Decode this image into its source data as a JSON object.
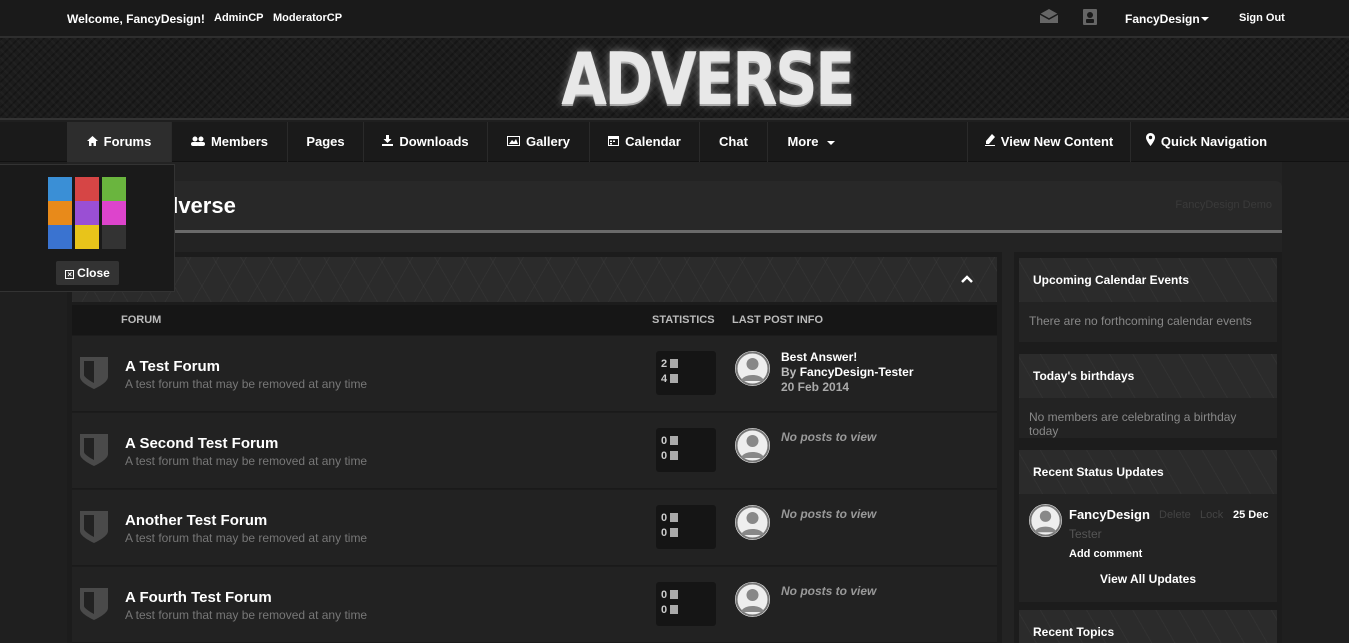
{
  "userbar": {
    "welcome": "Welcome, FancyDesign!",
    "admincp": "AdminCP",
    "moderatorcp": "ModeratorCP",
    "username": "FancyDesign",
    "signout": "Sign Out"
  },
  "header": {
    "logo": "ADVERSE"
  },
  "nav": {
    "forums": "Forums",
    "members": "Members",
    "pages": "Pages",
    "downloads": "Downloads",
    "gallery": "Gallery",
    "calendar": "Calendar",
    "chat": "Chat",
    "more": "More",
    "view_new": "View New Content",
    "quick_nav": "Quick Navigation"
  },
  "page": {
    "title": "Adverse",
    "demo_tag": "FancyDesign Demo"
  },
  "forum_table": {
    "col_forum": "FORUM",
    "col_statistics": "STATISTICS",
    "col_last_post": "LAST POST INFO",
    "rows": [
      {
        "name": "A Test Forum",
        "desc": "A test forum that may be removed at any time",
        "topics": "2",
        "replies": "4",
        "last_title": "Best Answer!",
        "last_by_prefix": "By",
        "last_by": "FancyDesign-Tester",
        "last_date": "20 Feb 2014"
      },
      {
        "name": "A Second Test Forum",
        "desc": "A test forum that may be removed at any time",
        "topics": "0",
        "replies": "0",
        "no_posts": "No posts to view"
      },
      {
        "name": "Another Test Forum",
        "desc": "A test forum that may be removed at any time",
        "topics": "0",
        "replies": "0",
        "no_posts": "No posts to view"
      },
      {
        "name": "A Fourth Test Forum",
        "desc": "A test forum that may be removed at any time",
        "topics": "0",
        "replies": "0",
        "no_posts": "No posts to view"
      }
    ]
  },
  "sidebar": {
    "calendar_title": "Upcoming Calendar Events",
    "calendar_body": "There are no forthcoming calendar events",
    "birthdays_title": "Today's birthdays",
    "birthdays_body": "No members are celebrating a birthday today",
    "status_title": "Recent Status Updates",
    "status_user": "FancyDesign",
    "status_delete": "Delete",
    "status_lock": "Lock",
    "status_date": "25 Dec",
    "status_text": "Tester",
    "status_add": "Add comment",
    "status_view_all": "View All Updates",
    "topics_title": "Recent Topics"
  },
  "switcher": {
    "close_label": "Close",
    "colors": [
      "#3a8fd6",
      "#d64545",
      "#6ab53e",
      "#e88a1a",
      "#9a4fd4",
      "#dd44cc",
      "#3a73d0",
      "#e8c41a",
      "#333333"
    ]
  },
  "icons": {
    "mail": "mail-icon",
    "profile": "profile-icon",
    "home": "home-icon",
    "members": "users-icon",
    "downloads": "download-icon",
    "gallery": "image-icon",
    "calendar": "calendar-icon",
    "view_new": "pen-icon",
    "quick_nav": "map-pin-icon",
    "collapse": "chevron-up-icon",
    "forum": "shield-icon",
    "stat": "document-icon",
    "avatar": "avatar-icon"
  }
}
